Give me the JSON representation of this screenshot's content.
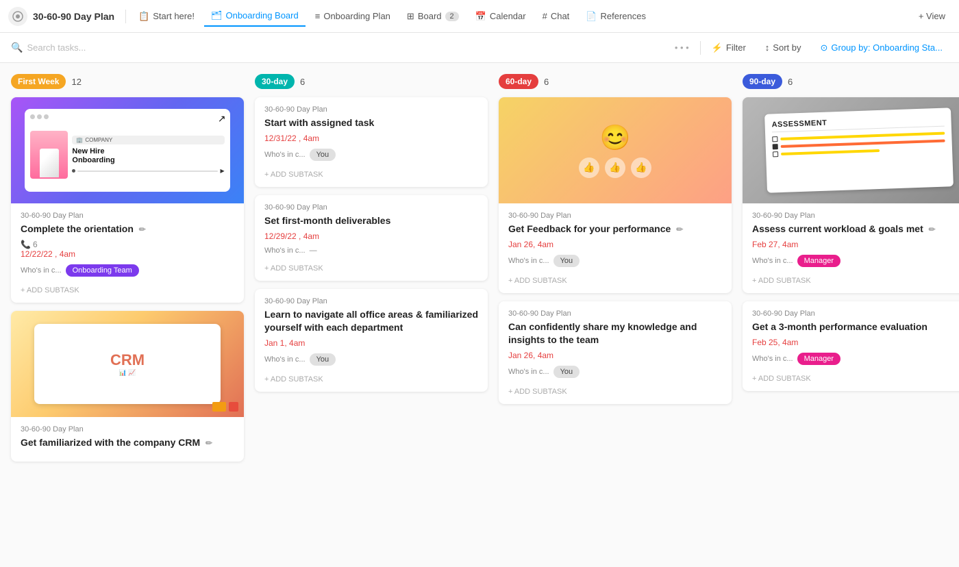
{
  "app": {
    "title": "30-60-90 Day Plan"
  },
  "nav": {
    "logo_icon": "⚙",
    "title": "30-60-90 Day Plan",
    "items": [
      {
        "id": "start-here",
        "label": "Start here!",
        "icon": "📋",
        "active": false
      },
      {
        "id": "onboarding-board",
        "label": "Onboarding Board",
        "icon": "🗂",
        "active": true
      },
      {
        "id": "onboarding-plan",
        "label": "Onboarding Plan",
        "icon": "≡",
        "active": false
      },
      {
        "id": "board",
        "label": "Board",
        "icon": "⊞",
        "active": false
      },
      {
        "id": "board-count",
        "label": "2",
        "active": false
      },
      {
        "id": "calendar",
        "label": "Calendar",
        "icon": "📅",
        "active": false
      },
      {
        "id": "chat",
        "label": "Chat",
        "icon": "#",
        "active": false
      },
      {
        "id": "references",
        "label": "References",
        "icon": "📄",
        "active": false
      },
      {
        "id": "view",
        "label": "+ View",
        "active": false
      }
    ]
  },
  "toolbar": {
    "search_placeholder": "Search tasks...",
    "filter_label": "Filter",
    "sort_label": "Sort by",
    "group_label": "Group by: Onboarding Sta..."
  },
  "columns": [
    {
      "id": "first-week",
      "badge": "First Week",
      "badge_class": "badge-yellow",
      "count": "12",
      "cards": [
        {
          "id": "orientation",
          "has_image": true,
          "image_type": "onboarding",
          "plan": "30-60-90 Day Plan",
          "title": "Complete the orientation",
          "has_title_icon": true,
          "phone_count": "6",
          "date": "12/22/22 , 4am",
          "whos_in": "Who's in c...",
          "assignee": "Onboarding Team",
          "assignee_class": "tag-purple",
          "has_subtask": true
        },
        {
          "id": "crm",
          "has_image": true,
          "image_type": "crm",
          "plan": "30-60-90 Day Plan",
          "title": "Get familiarized with the company CRM",
          "has_title_icon": true,
          "date": "",
          "whos_in": "",
          "assignee": "",
          "has_subtask": false
        }
      ]
    },
    {
      "id": "30-day",
      "badge": "30-day",
      "badge_class": "badge-teal",
      "count": "6",
      "cards": [
        {
          "id": "assigned-task",
          "has_image": false,
          "plan": "30-60-90 Day Plan",
          "title": "Start with assigned task",
          "has_title_icon": false,
          "date": "12/31/22 , 4am",
          "whos_in": "Who's in c...",
          "assignee": "You",
          "assignee_class": "tag-gray",
          "has_subtask": true
        },
        {
          "id": "deliverables",
          "has_image": false,
          "plan": "30-60-90 Day Plan",
          "title": "Set first-month deliverables",
          "has_title_icon": false,
          "date": "12/29/22 , 4am",
          "whos_in": "Who's in c...",
          "assignee": "—",
          "assignee_class": "",
          "has_subtask": true
        },
        {
          "id": "office-areas",
          "has_image": false,
          "plan": "30-60-90 Day Plan",
          "title": "Learn to navigate all office areas & familiarized yourself with each department",
          "has_title_icon": false,
          "date": "Jan 1, 4am",
          "whos_in": "Who's in c...",
          "assignee": "You",
          "assignee_class": "tag-gray",
          "has_subtask": true
        }
      ]
    },
    {
      "id": "60-day",
      "badge": "60-day",
      "badge_class": "badge-red",
      "count": "6",
      "cards": [
        {
          "id": "feedback",
          "has_image": true,
          "image_type": "performance",
          "plan": "30-60-90 Day Plan",
          "title": "Get Feedback for your performance",
          "has_title_icon": true,
          "date": "Jan 26, 4am",
          "whos_in": "Who's in c...",
          "assignee": "You",
          "assignee_class": "tag-gray",
          "has_subtask": true
        },
        {
          "id": "knowledge-share",
          "has_image": false,
          "plan": "30-60-90 Day Plan",
          "title": "Can confidently share my knowledge and insights to the team",
          "has_title_icon": false,
          "date": "Jan 26, 4am",
          "whos_in": "Who's in c...",
          "assignee": "You",
          "assignee_class": "tag-gray",
          "has_subtask": true
        }
      ]
    },
    {
      "id": "90-day",
      "badge": "90-day",
      "badge_class": "badge-blue",
      "count": "6",
      "cards": [
        {
          "id": "workload",
          "has_image": true,
          "image_type": "assessment",
          "plan": "30-60-90 Day Plan",
          "title": "Assess current workload & goals met",
          "has_title_icon": true,
          "date": "Feb 27, 4am",
          "whos_in": "Who's in c...",
          "assignee": "Manager",
          "assignee_class": "tag-pink",
          "has_subtask": true
        },
        {
          "id": "evaluation",
          "has_image": false,
          "plan": "30-60-90 Day Plan",
          "title": "Get a 3-month performance evaluation",
          "has_title_icon": false,
          "date": "Feb 25, 4am",
          "whos_in": "Who's in c...",
          "assignee": "Manager",
          "assignee_class": "tag-pink",
          "has_subtask": true
        }
      ]
    }
  ],
  "labels": {
    "add_subtask": "+ ADD SUBTASK",
    "whos_in": "Who's in c..."
  }
}
